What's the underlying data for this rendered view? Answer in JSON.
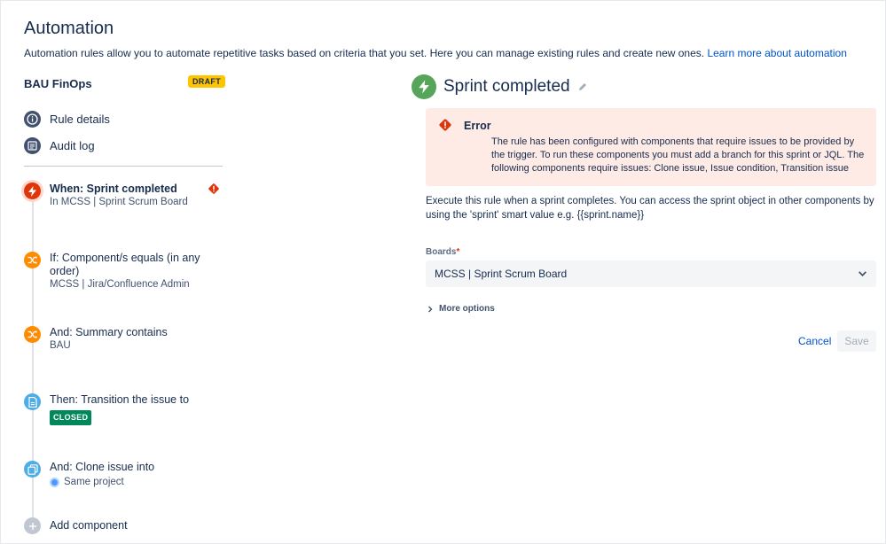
{
  "header": {
    "title": "Automation",
    "description": "Automation rules allow you to automate repetitive tasks based on criteria that you set. Here you can manage existing rules and create new ones.",
    "learn_more": "Learn more about automation"
  },
  "rule": {
    "name": "BAU FinOps",
    "status": "DRAFT"
  },
  "nav": [
    {
      "label": "Rule details",
      "icon": "info-icon"
    },
    {
      "label": "Audit log",
      "icon": "list-icon"
    }
  ],
  "steps": [
    {
      "title": "When: Sprint completed",
      "sub": "In MCSS | Sprint Scrum Board",
      "icon": "lightning-icon",
      "color": "#de350b",
      "has_error": true
    },
    {
      "title": "If: Component/s equals (in any order)",
      "sub": "MCSS | Jira/Confluence Admin",
      "icon": "shuffle-icon",
      "color": "#ff8b00"
    },
    {
      "title": "And: Summary contains",
      "sub": "BAU",
      "icon": "shuffle-icon",
      "color": "#ff8b00"
    },
    {
      "title": "Then: Transition the issue to",
      "badge": "CLOSED",
      "icon": "document-icon",
      "color": "#4fade6"
    },
    {
      "title": "And: Clone issue into",
      "sub": "Same project",
      "icon": "copy-icon",
      "color": "#4fade6"
    }
  ],
  "add_component": "Add component",
  "trigger": {
    "title": "Sprint completed",
    "icon": "lightning-icon"
  },
  "error": {
    "title": "Error",
    "message": "The rule has been configured with components that require issues to be provided by the trigger. To run these components you must add a branch for this sprint or JQL. The following components require issues: Clone issue, Issue condition, Transition issue"
  },
  "description": "Execute this rule when a sprint completes. You can access the sprint object in other components by using the 'sprint' smart value e.g. {{sprint.name}}",
  "boards": {
    "label": "Boards",
    "required_marker": "*",
    "value": "MCSS | Sprint Scrum Board"
  },
  "more_options": "More options",
  "buttons": {
    "cancel": "Cancel",
    "save": "Save"
  },
  "colors": {
    "accent": "#0052cc",
    "error_bg": "#ffebe6",
    "draft": "#ffc400",
    "closed": "#00875a",
    "trigger": "#57a55a"
  }
}
